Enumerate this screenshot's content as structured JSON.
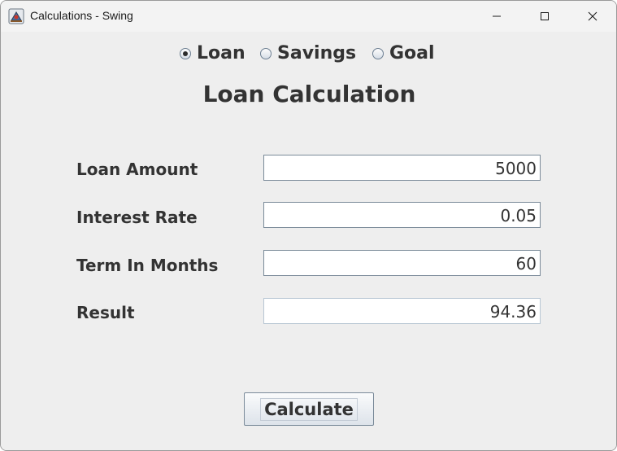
{
  "window": {
    "title": "Calculations - Swing"
  },
  "mode_selector": {
    "options": [
      {
        "label": "Loan",
        "checked": true
      },
      {
        "label": "Savings",
        "checked": false
      },
      {
        "label": "Goal",
        "checked": false
      }
    ]
  },
  "heading": "Loan Calculation",
  "fields": {
    "loan_amount": {
      "label": "Loan Amount",
      "value": "5000"
    },
    "interest_rate": {
      "label": "Interest Rate",
      "value": "0.05"
    },
    "term_in_months": {
      "label": "Term In Months",
      "value": "60"
    },
    "result": {
      "label": "Result",
      "value": "94.36"
    }
  },
  "calculate_button": {
    "label": "Calculate"
  },
  "icons": {
    "app": "java-coffee-icon",
    "minimize": "minimize-icon",
    "maximize": "maximize-icon",
    "close": "close-icon"
  }
}
